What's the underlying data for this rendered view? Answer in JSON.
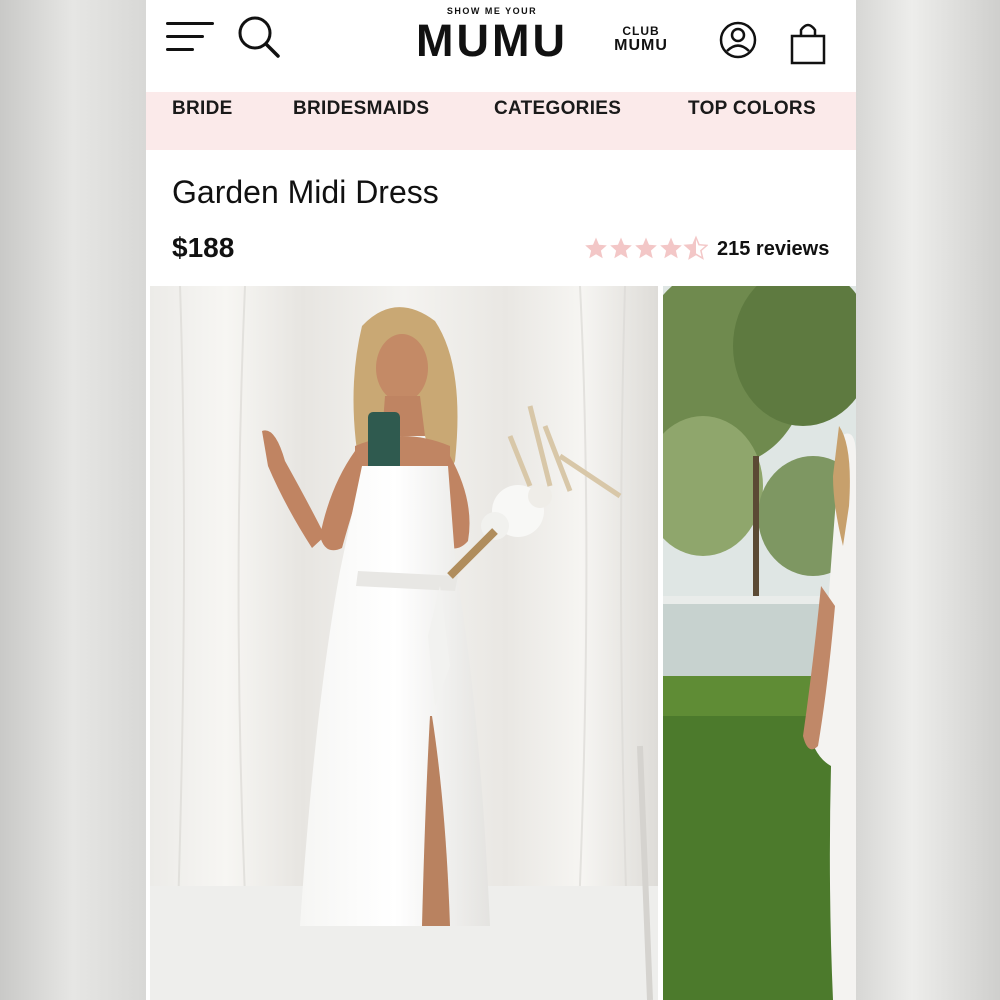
{
  "header": {
    "brand_small": "SHOW ME YOUR",
    "brand_big": "MUMU",
    "club_top": "CLUB",
    "club_bottom": "MUMU",
    "icons": [
      "menu-icon",
      "search-icon",
      "account-icon",
      "shopping-bag-icon"
    ]
  },
  "nav": {
    "items": [
      {
        "label": "BRIDE"
      },
      {
        "label": "BRIDESMAIDS"
      },
      {
        "label": "CATEGORIES"
      },
      {
        "label": "TOP COLORS"
      }
    ],
    "background": "#fbeaea"
  },
  "product": {
    "title": "Garden Midi Dress",
    "price": "$188",
    "rating": 4.5,
    "rating_max": 5,
    "reviews": "215 reviews",
    "star_color": "#f3c7c7"
  },
  "images": [
    {
      "name": "product-photo-main"
    },
    {
      "name": "product-photo-secondary"
    }
  ]
}
